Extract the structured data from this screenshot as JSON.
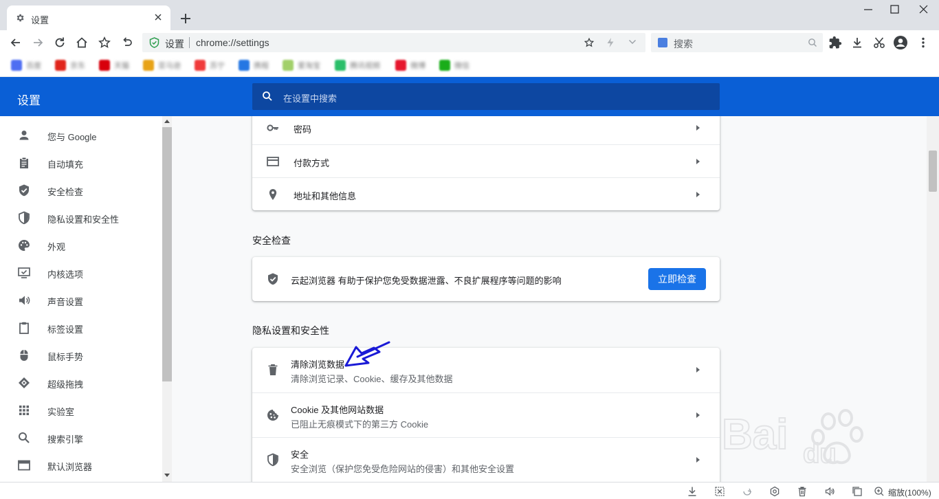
{
  "tab": {
    "title": "设置"
  },
  "omnibox": {
    "site": "设置",
    "url": "chrome://settings"
  },
  "search": {
    "placeholder": "搜索"
  },
  "bookmarks": [
    {
      "label": "百度",
      "color": "#4e6ef2"
    },
    {
      "label": "京东",
      "color": "#e1251b"
    },
    {
      "label": "天猫",
      "color": "#d8000c"
    },
    {
      "label": "亚马逊",
      "color": "#e8a317"
    },
    {
      "label": "苏宁",
      "color": "#f03a3a"
    },
    {
      "label": "携程",
      "color": "#2577e3"
    },
    {
      "label": "爱淘宝",
      "color": "#a2d06a"
    },
    {
      "label": "腾讯视频",
      "color": "#2bbf6a"
    },
    {
      "label": "微博",
      "color": "#e6162d"
    },
    {
      "label": "微信",
      "color": "#1aad19"
    }
  ],
  "header": {
    "title": "设置",
    "search_placeholder": "在设置中搜索"
  },
  "sidebar": {
    "items": [
      {
        "label": "您与 Google",
        "icon": "person-icon"
      },
      {
        "label": "自动填充",
        "icon": "clipboard-icon"
      },
      {
        "label": "安全检查",
        "icon": "shield-check-icon"
      },
      {
        "label": "隐私设置和安全性",
        "icon": "shield-half-icon"
      },
      {
        "label": "外观",
        "icon": "palette-icon"
      },
      {
        "label": "内核选项",
        "icon": "monitor-check-icon"
      },
      {
        "label": "声音设置",
        "icon": "speaker-icon"
      },
      {
        "label": "标签设置",
        "icon": "tab-clipboard-icon"
      },
      {
        "label": "鼠标手势",
        "icon": "mouse-icon"
      },
      {
        "label": "超级拖拽",
        "icon": "drag-icon"
      },
      {
        "label": "实验室",
        "icon": "grid-icon"
      },
      {
        "label": "搜索引擎",
        "icon": "search-icon"
      },
      {
        "label": "默认浏览器",
        "icon": "browser-window-icon"
      }
    ]
  },
  "autofill_rows": [
    {
      "label": "密码",
      "icon": "key-icon"
    },
    {
      "label": "付款方式",
      "icon": "credit-card-icon"
    },
    {
      "label": "地址和其他信息",
      "icon": "location-pin-icon"
    }
  ],
  "safety_check": {
    "title": "安全检查",
    "text": "云起浏览器 有助于保护您免受数据泄露、不良扩展程序等问题的影响",
    "button": "立即检查"
  },
  "privacy": {
    "title": "隐私设置和安全性",
    "rows": [
      {
        "label": "清除浏览数据",
        "sub": "清除浏览记录、Cookie、缓存及其他数据",
        "icon": "trash-icon"
      },
      {
        "label": "Cookie 及其他网站数据",
        "sub": "已阻止无痕模式下的第三方 Cookie",
        "icon": "cookie-icon"
      },
      {
        "label": "安全",
        "sub": "安全浏览（保护您免受危险网站的侵害）和其他安全设置",
        "icon": "security-shield-icon"
      }
    ]
  },
  "statusbar": {
    "zoom": "缩放(100%)"
  },
  "colors": {
    "accent": "#1a73e8",
    "header": "#0a5fd6",
    "annotation": "#1a1ad6"
  }
}
